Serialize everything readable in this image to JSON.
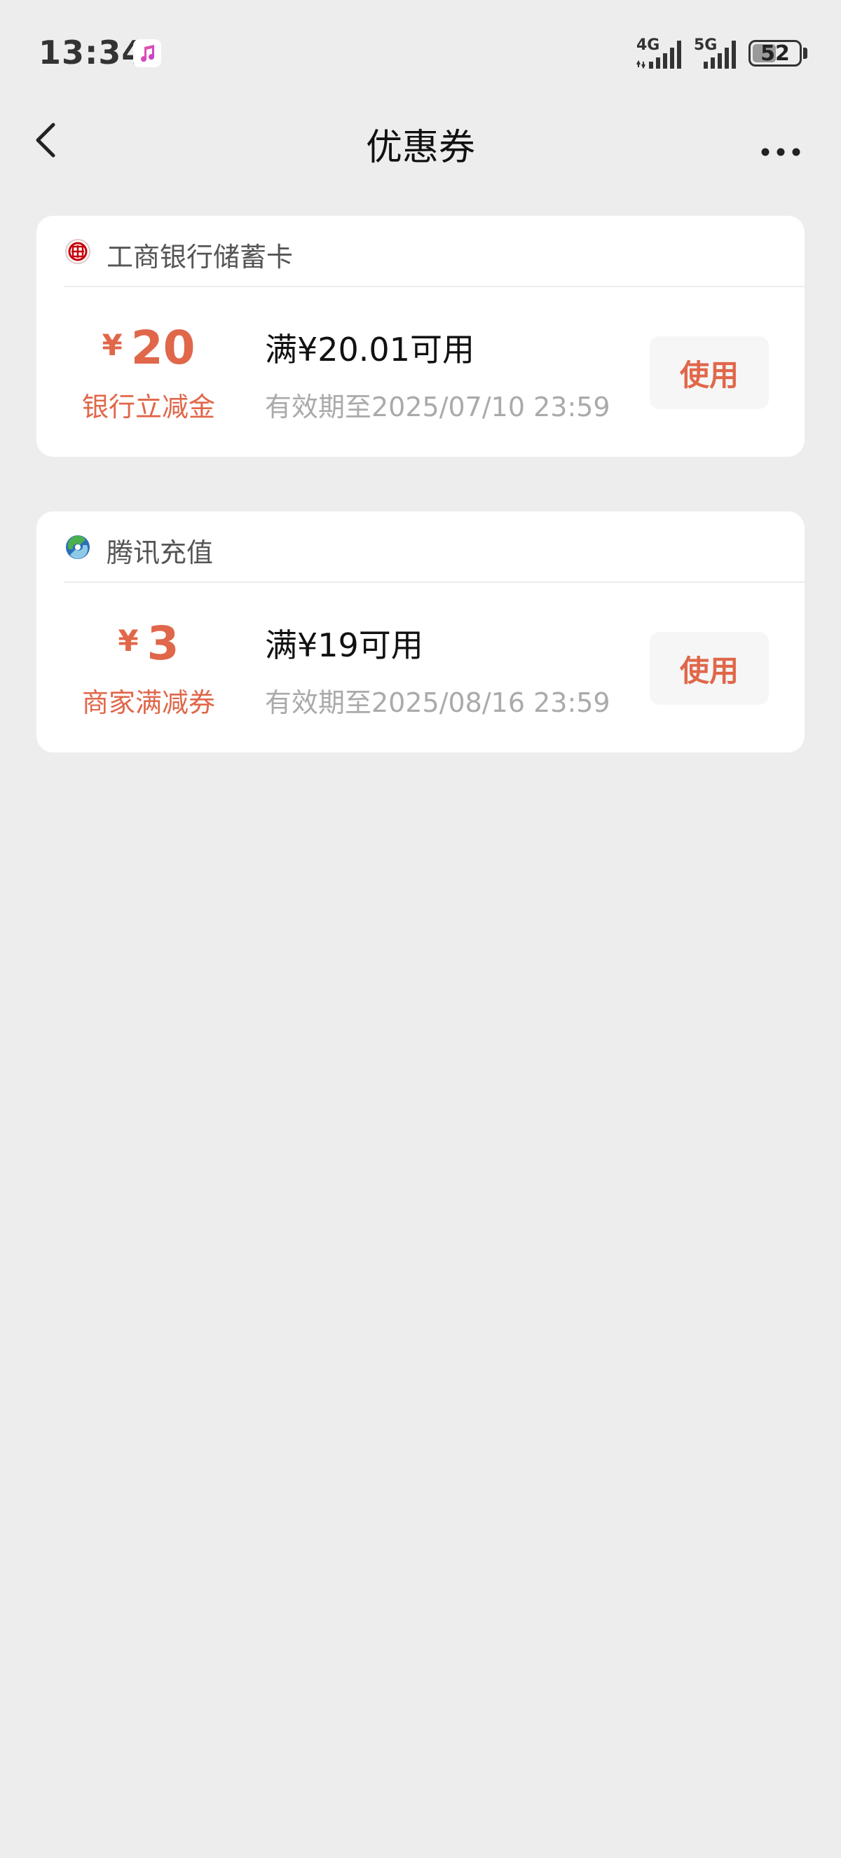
{
  "status_bar": {
    "time": "13:34",
    "network_1": "4G",
    "network_2": "5G",
    "battery": "52",
    "battery_level": 0.52
  },
  "nav": {
    "title": "优惠券"
  },
  "coupons": [
    {
      "merchant": "工商银行储蓄卡",
      "currency": "¥",
      "amount": "20",
      "type": "银行立减金",
      "condition": "满¥20.01可用",
      "validity": "有效期至2025/07/10 23:59",
      "button": "使用"
    },
    {
      "merchant": "腾讯充值",
      "currency": "¥",
      "amount": "3",
      "type": "商家满减券",
      "condition": "满¥19可用",
      "validity": "有效期至2025/08/16 23:59",
      "button": "使用"
    }
  ],
  "colors": {
    "accent": "#e0674a",
    "background": "#ededed",
    "card": "#ffffff",
    "icbc_red": "#c7000b"
  }
}
